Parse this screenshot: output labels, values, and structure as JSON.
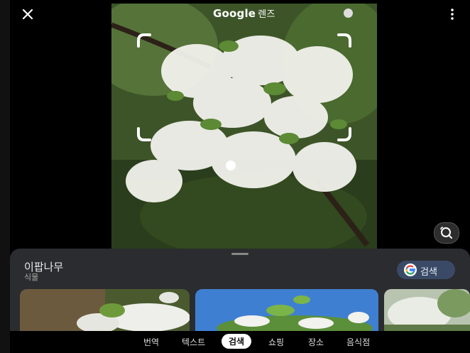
{
  "header": {
    "title": "Google",
    "title_suffix": "렌즈"
  },
  "icons": {
    "close": "close-icon",
    "more": "more-vert-icon",
    "lens": "lens-search-icon"
  },
  "result": {
    "name": "이팝나무",
    "category": "식물",
    "search_label": "검색"
  },
  "nav": {
    "tabs": [
      "번역",
      "텍스트",
      "검색",
      "쇼핑",
      "장소",
      "음식점"
    ],
    "active_tab": "검색"
  },
  "colors": {
    "sheet": "#2b2c2f",
    "search_button": "#3a4a66",
    "accent_blue": "#4285f4"
  }
}
